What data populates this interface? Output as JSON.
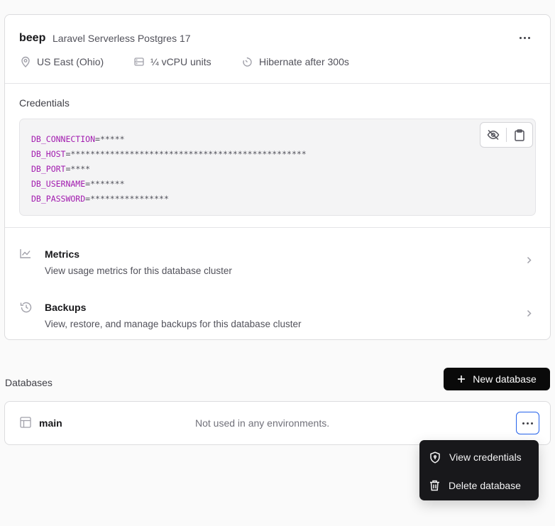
{
  "cluster": {
    "name": "beep",
    "engine": "Laravel Serverless Postgres 17",
    "region": "US East (Ohio)",
    "compute": "¼ vCPU units",
    "hibernate": "Hibernate after 300s"
  },
  "credentials": {
    "label": "Credentials",
    "lines": [
      {
        "key": "DB_CONNECTION",
        "value": "=*****"
      },
      {
        "key": "DB_HOST",
        "value": "=************************************************"
      },
      {
        "key": "DB_PORT",
        "value": "=****"
      },
      {
        "key": "DB_USERNAME",
        "value": "=*******"
      },
      {
        "key": "DB_PASSWORD",
        "value": "=****************"
      }
    ]
  },
  "links": {
    "metrics": {
      "title": "Metrics",
      "description": "View usage metrics for this database cluster"
    },
    "backups": {
      "title": "Backups",
      "description": "View, restore, and manage backups for this database cluster"
    }
  },
  "databases": {
    "label": "Databases",
    "new_button": "New database",
    "items": [
      {
        "name": "main",
        "status": "Not used in any environments."
      }
    ]
  },
  "menu": {
    "view_credentials": "View credentials",
    "delete_database": "Delete database"
  },
  "colors": {
    "accent_focus": "#2563eb",
    "env_key": "#a21caf",
    "button_dark": "#0a0a0a"
  },
  "icons": [
    "map-pin-icon",
    "server-icon",
    "timer-icon",
    "eye-off-icon",
    "clipboard-icon",
    "chart-line-icon",
    "history-icon",
    "chevron-right-icon",
    "plus-icon",
    "table-icon",
    "more-horizontal-icon",
    "shield-icon",
    "trash-icon"
  ]
}
